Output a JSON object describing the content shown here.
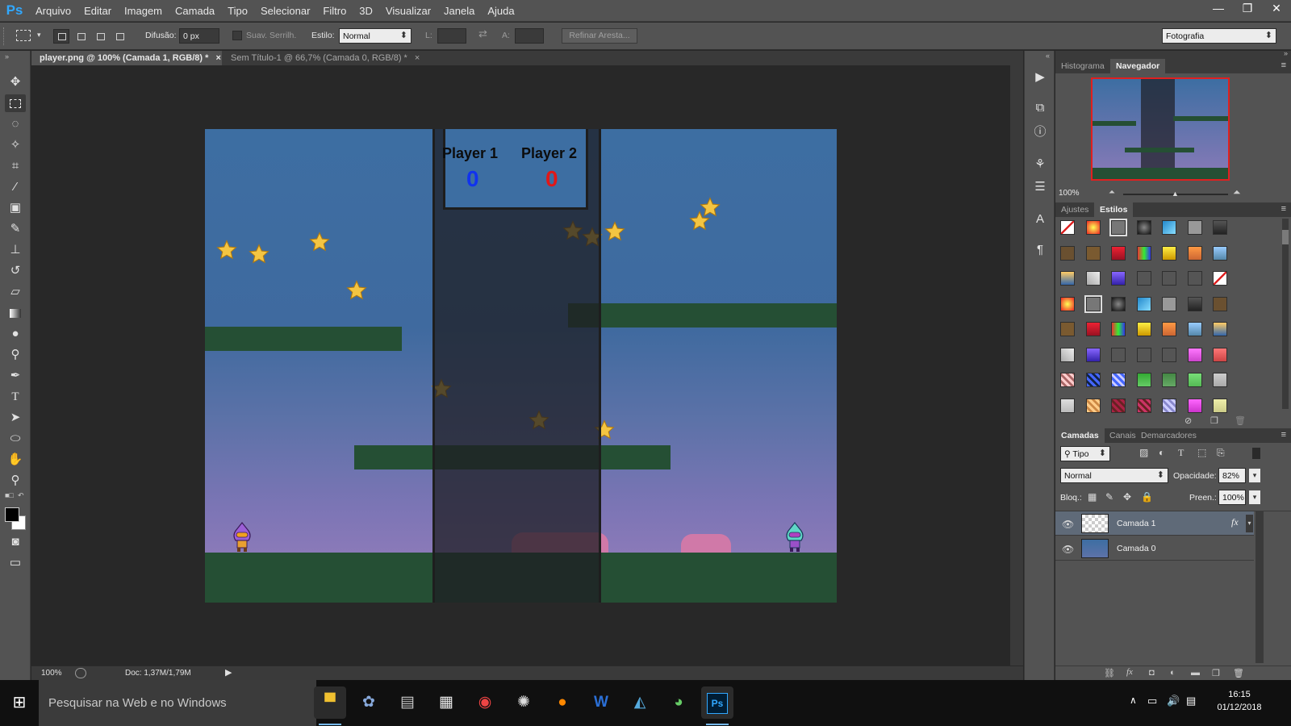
{
  "app": {
    "logo": "Ps",
    "menu": [
      "Arquivo",
      "Editar",
      "Imagem",
      "Camada",
      "Tipo",
      "Selecionar",
      "Filtro",
      "3D",
      "Visualizar",
      "Janela",
      "Ajuda"
    ],
    "window_controls": [
      "—",
      "❐",
      "✕"
    ]
  },
  "options_bar": {
    "feather_label": "Difusão:",
    "feather_value": "0 px",
    "antialias_label": "Suav. Serrilh.",
    "style_label": "Estilo:",
    "style_value": "Normal",
    "width_label": "L:",
    "height_label": "A:",
    "refine_edge_label": "Refinar Aresta...",
    "workspace_value": "Fotografia"
  },
  "tabs": [
    {
      "label": "player.png @ 100% (Camada 1, RGB/8) *",
      "close": "×"
    },
    {
      "label": "Sem Título-1 @ 66,7% (Camada 0, RGB/8) *",
      "close": "×"
    }
  ],
  "canvas": {
    "scoreboard": {
      "player1_label": "Player 1",
      "player1_score": "0",
      "player2_label": "Player 2",
      "player2_score": "0",
      "player1_color": "#1133ee",
      "player2_color": "#e01818"
    },
    "colors": {
      "sky_top": "#3d6ea2",
      "sky_bottom": "#9a7fbc",
      "platform": "#254f34",
      "star": "#f4c542"
    }
  },
  "status": {
    "zoom": "100%",
    "doc_info": "Doc: 1,37M/1,79M"
  },
  "navigator": {
    "tabs": [
      "Histograma",
      "Navegador"
    ],
    "zoom": "100%"
  },
  "styles_panel": {
    "tabs": [
      "Ajustes",
      "Estilos"
    ]
  },
  "layers_panel": {
    "tabs": [
      "Camadas",
      "Canais",
      "Demarcadores"
    ],
    "filter_label": "Tipo",
    "blend_mode": "Normal",
    "opacity_label": "Opacidade:",
    "opacity_value": "82%",
    "lock_label": "Bloq.:",
    "fill_label": "Preen.:",
    "fill_value": "100%",
    "layers": [
      {
        "name": "Camada 1",
        "fx": "fx",
        "selected": true
      },
      {
        "name": "Camada 0",
        "selected": false
      }
    ]
  },
  "taskbar": {
    "search_placeholder": "Pesquisar na Web e no Windows",
    "time": "16:15",
    "date": "01/12/2018"
  }
}
